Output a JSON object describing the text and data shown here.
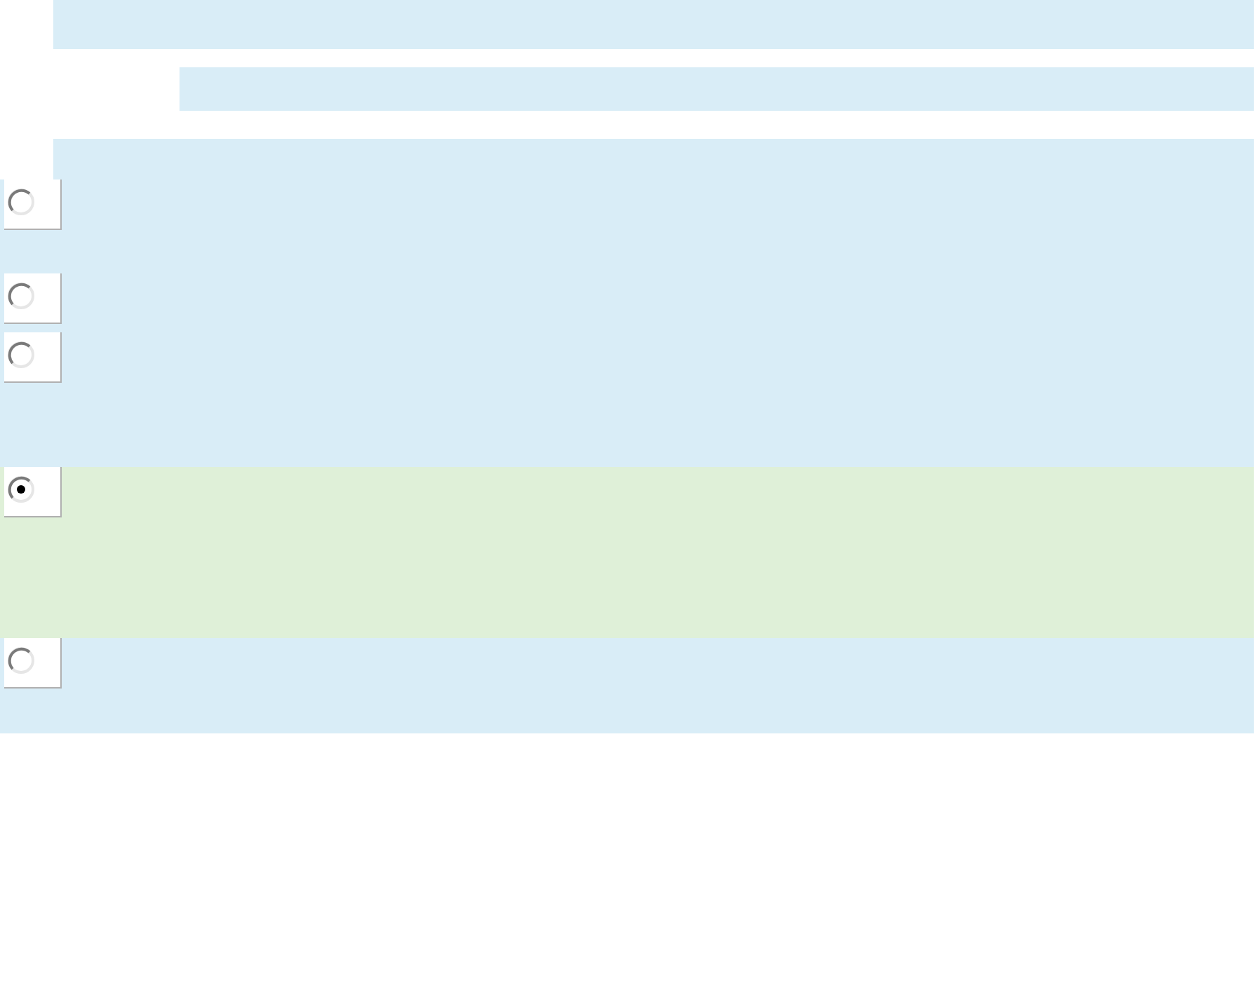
{
  "answers": [
    {
      "selected": false
    },
    {
      "selected": false
    },
    {
      "selected": false
    },
    {
      "selected": true
    },
    {
      "selected": false
    }
  ]
}
